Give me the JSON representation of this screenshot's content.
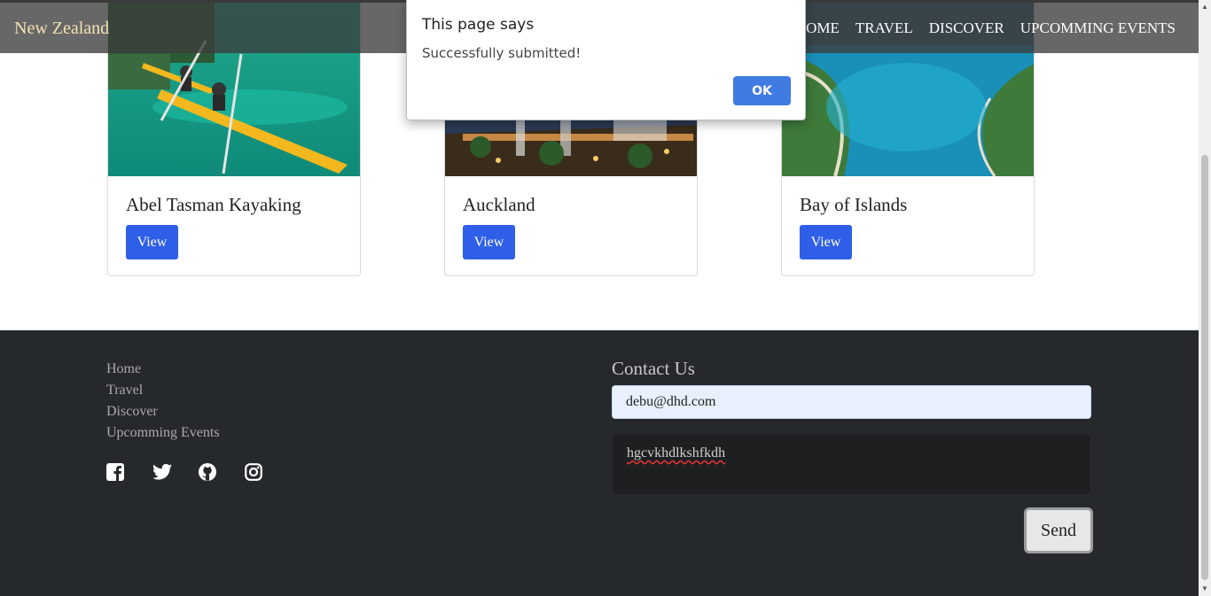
{
  "navbar": {
    "brand": "New Zealand",
    "links": [
      "HOME",
      "TRAVEL",
      "DISCOVER",
      "UPCOMMING EVENTS"
    ]
  },
  "cards": [
    {
      "title": "Abel Tasman Kayaking",
      "button": "View"
    },
    {
      "title": "Auckland",
      "button": "View"
    },
    {
      "title": "Bay of Islands",
      "button": "View"
    }
  ],
  "footer": {
    "links": [
      "Home",
      "Travel",
      "Discover",
      "Upcomming Events"
    ],
    "social_icons": [
      "facebook-icon",
      "twitter-icon",
      "github-icon",
      "instagram-icon"
    ],
    "contact": {
      "title": "Contact Us",
      "email_value": "debu@dhd.com",
      "message_value": "hgcvkhdlkshfkdh",
      "send_label": "Send"
    }
  },
  "dialog": {
    "title": "This page says",
    "message": "Successfully submitted!",
    "ok_label": "OK"
  },
  "colors": {
    "brand_text": "#f3e2b0",
    "button_blue": "#2f5fe8",
    "footer_bg": "#26292c",
    "dialog_ok": "#3f7be0"
  }
}
